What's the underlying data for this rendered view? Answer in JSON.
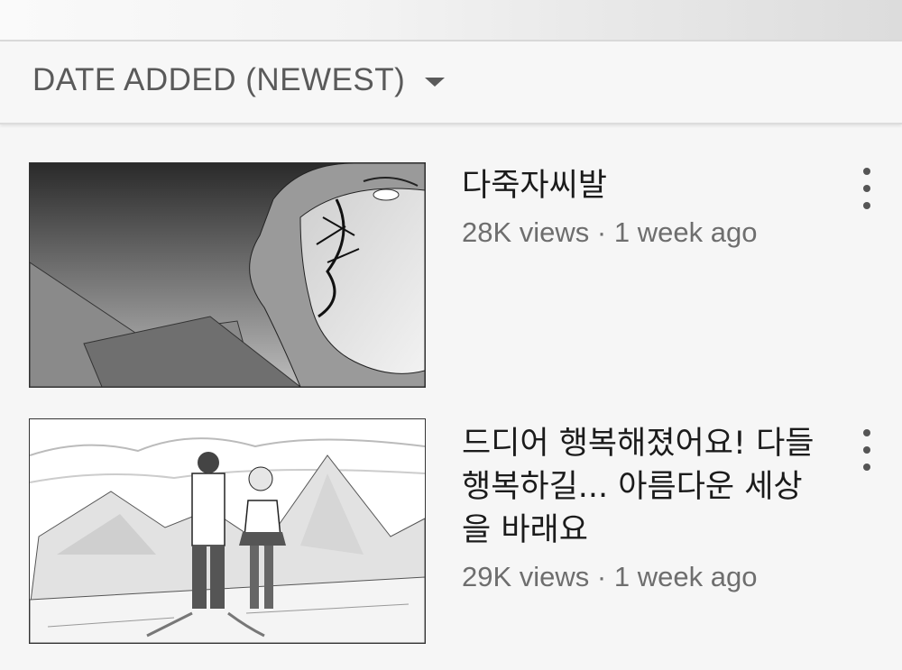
{
  "sort": {
    "label": "DATE ADDED (NEWEST)",
    "icon": "caret-down-icon"
  },
  "videos": [
    {
      "title": "다죽자씨발",
      "views": "28K views",
      "separator": "·",
      "age": "1 week ago"
    },
    {
      "title": "드디어 행복해졌어요! 다들 행복하길... 아름다운 세상을 바래요",
      "views": "29K views",
      "separator": "·",
      "age": "1 week ago"
    }
  ]
}
